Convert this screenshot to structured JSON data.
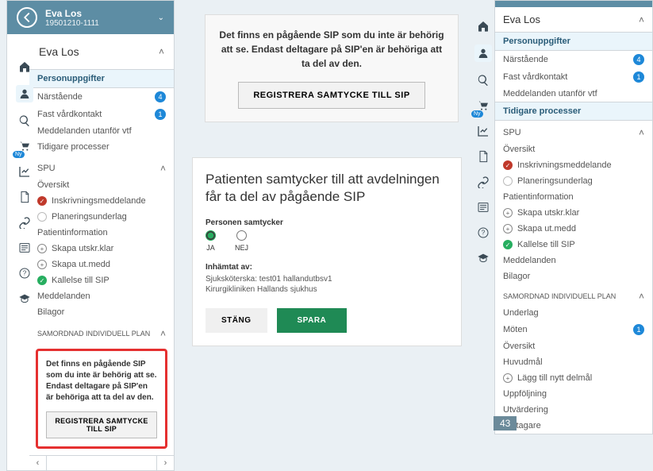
{
  "header": {
    "name": "Eva Los",
    "id": "19501210-1111"
  },
  "left": {
    "name": "Eva Los",
    "personuppgifter": "Personuppgifter",
    "narstaende": "Närstående",
    "narstaende_count": "4",
    "fast": "Fast vårdkontakt",
    "fast_count": "1",
    "medd_utanfor": "Meddelanden utanför vtf",
    "tidigare": "Tidigare processer",
    "spu": "SPU",
    "oversikt": "Översikt",
    "inskrivning": "Inskrivningsmeddelande",
    "planering": "Planeringsunderlag",
    "patientinfo": "Patientinformation",
    "skapa_utskr": "Skapa utskr.klar",
    "skapa_utmedd": "Skapa ut.medd",
    "kallelse": "Kallelse till SIP",
    "meddelanden": "Meddelanden",
    "bilagor": "Bilagor",
    "samordnad": "SAMORDNAD INDIVIDUELL PLAN"
  },
  "sip": {
    "text": "Det finns en pågående SIP som du inte är behörig att se. Endast deltagare på SIP'en är behöriga att ta del av den.",
    "button": "REGISTRERA SAMTYCKE TILL SIP"
  },
  "consent": {
    "title": "Patienten samtycker till att avdelningen får ta del av pågående SIP",
    "personen": "Personen samtycker",
    "ja": "JA",
    "nej": "NEJ",
    "inhamtat": "Inhämtat av:",
    "line1": "Sjuksköterska: test01 hallandutbsv1",
    "line2": "Kirurgikliniken Hallands sjukhus",
    "stang": "STÄNG",
    "spara": "SPARA"
  },
  "right": {
    "name": "Eva Los",
    "underlag": "Underlag",
    "moten": "Möten",
    "moten_count": "1",
    "oversikt": "Översikt",
    "huvudmal": "Huvudmål",
    "lagg_delmal": "Lägg till nytt delmål",
    "uppfoljning": "Uppföljning",
    "utvardering": "Utvärdering",
    "deltagare": "Deltagare"
  },
  "page": "43"
}
